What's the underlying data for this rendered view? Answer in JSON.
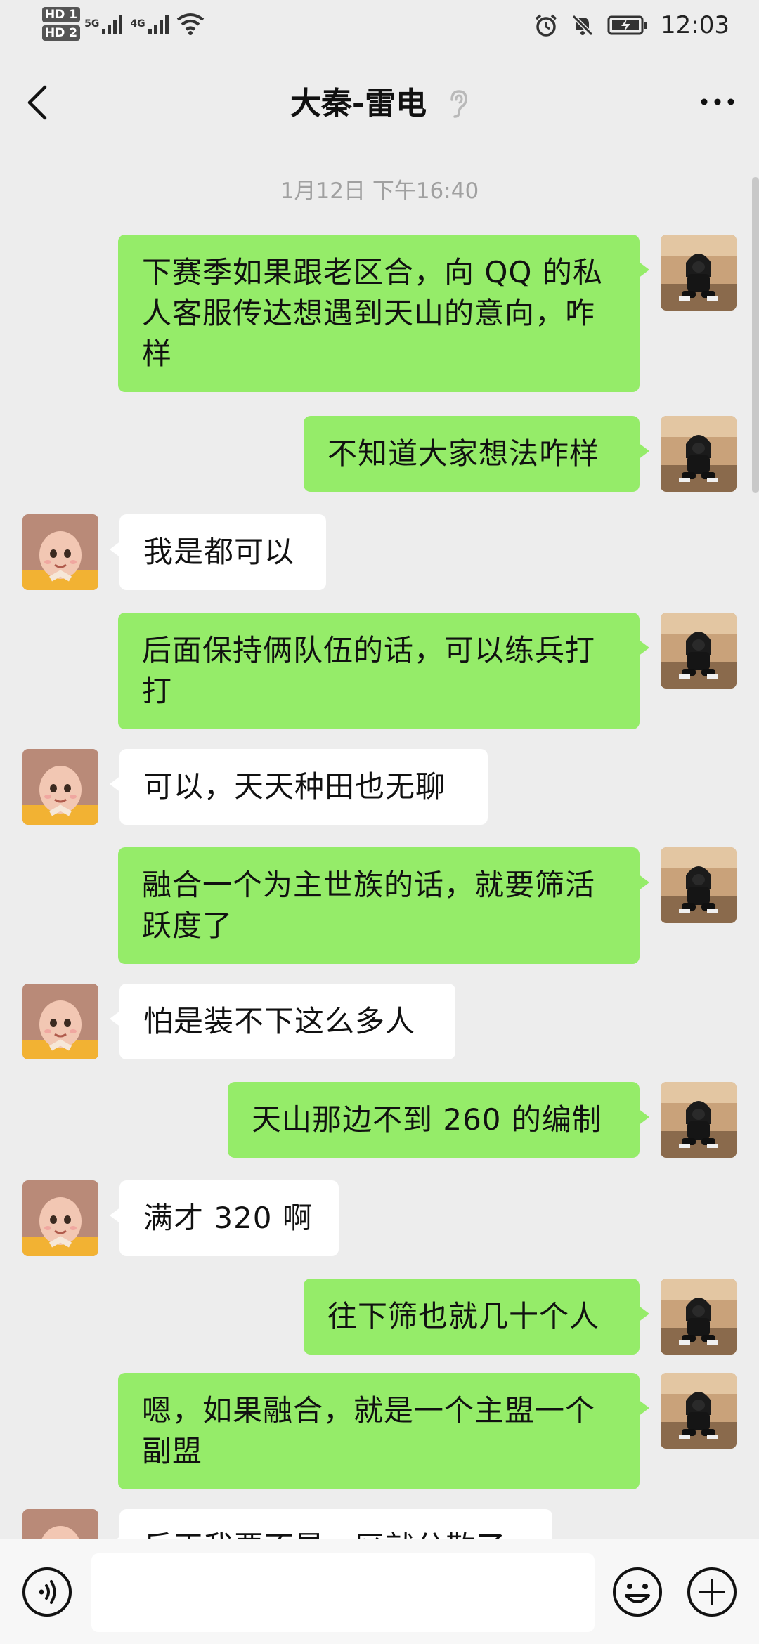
{
  "status_bar": {
    "hd1": "HD 1",
    "hd2": "HD 2",
    "net1": "5G",
    "net2": "4G",
    "time": "12:03"
  },
  "nav": {
    "title": "大秦-雷电",
    "back_icon": "chevron-left-icon",
    "earpiece_icon": "ear-icon",
    "more_icon": "more-dots-icon"
  },
  "chat": {
    "timestamp": "1月12日 下午16:40",
    "messages": [
      {
        "side": "right",
        "text": "下赛季如果跟老区合，向 QQ 的私人客服传达想遇到天山的意向，咋样"
      },
      {
        "side": "right",
        "text": "不知道大家想法咋样"
      },
      {
        "side": "left",
        "text": "我是都可以"
      },
      {
        "side": "right",
        "text": "后面保持俩队伍的话，可以练兵打打"
      },
      {
        "side": "left",
        "text": "可以，天天种田也无聊"
      },
      {
        "side": "right",
        "text": "融合一个为主世族的话，就要筛活跃度了"
      },
      {
        "side": "left",
        "text": "怕是装不下这么多人"
      },
      {
        "side": "right",
        "text": "天山那边不到 260 的编制"
      },
      {
        "side": "left",
        "text": "满才 320 啊"
      },
      {
        "side": "right",
        "text": "往下筛也就几十个人"
      },
      {
        "side": "right",
        "text": "嗯，如果融合，就是一个主盟一个副盟"
      },
      {
        "side": "left",
        "text": "反正我要不是一区就分散了"
      }
    ]
  },
  "input_bar": {
    "voice_icon": "voice-icon",
    "emoji_icon": "emoji-icon",
    "plus_icon": "plus-icon",
    "input_value": ""
  },
  "colors": {
    "sent_bubble": "#95ec69",
    "received_bubble": "#ffffff",
    "background": "#ededed"
  }
}
